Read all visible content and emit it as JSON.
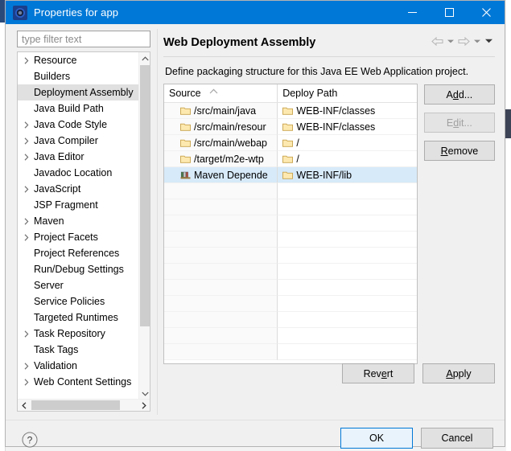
{
  "window": {
    "title": "Properties for app",
    "icon": "gear-icon",
    "accent_color": "#0078d7",
    "controls": {
      "minimize": "minimize-icon",
      "maximize": "maximize-icon",
      "close": "close-icon"
    }
  },
  "filter": {
    "placeholder": "type filter text",
    "value": ""
  },
  "tree": {
    "items": [
      {
        "label": "Resource",
        "expandable": true,
        "selected": false
      },
      {
        "label": "Builders",
        "expandable": false,
        "selected": false
      },
      {
        "label": "Deployment Assembly",
        "expandable": false,
        "selected": true
      },
      {
        "label": "Java Build Path",
        "expandable": false,
        "selected": false
      },
      {
        "label": "Java Code Style",
        "expandable": true,
        "selected": false
      },
      {
        "label": "Java Compiler",
        "expandable": true,
        "selected": false
      },
      {
        "label": "Java Editor",
        "expandable": true,
        "selected": false
      },
      {
        "label": "Javadoc Location",
        "expandable": false,
        "selected": false
      },
      {
        "label": "JavaScript",
        "expandable": true,
        "selected": false
      },
      {
        "label": "JSP Fragment",
        "expandable": false,
        "selected": false
      },
      {
        "label": "Maven",
        "expandable": true,
        "selected": false
      },
      {
        "label": "Project Facets",
        "expandable": true,
        "selected": false
      },
      {
        "label": "Project References",
        "expandable": false,
        "selected": false
      },
      {
        "label": "Run/Debug Settings",
        "expandable": false,
        "selected": false
      },
      {
        "label": "Server",
        "expandable": false,
        "selected": false
      },
      {
        "label": "Service Policies",
        "expandable": false,
        "selected": false
      },
      {
        "label": "Targeted Runtimes",
        "expandable": false,
        "selected": false
      },
      {
        "label": "Task Repository",
        "expandable": true,
        "selected": false
      },
      {
        "label": "Task Tags",
        "expandable": false,
        "selected": false
      },
      {
        "label": "Validation",
        "expandable": true,
        "selected": false
      },
      {
        "label": "Web Content Settings",
        "expandable": true,
        "selected": false
      }
    ]
  },
  "page": {
    "title": "Web Deployment Assembly",
    "description": "Define packaging structure for this Java EE Web Application project.",
    "nav": {
      "back": "back-arrow-icon",
      "back_menu": "chevron-down-icon",
      "forward": "forward-arrow-icon",
      "forward_menu": "chevron-down-icon",
      "view_menu": "chevron-down-icon"
    }
  },
  "table": {
    "columns": [
      "Source",
      "Deploy Path"
    ],
    "sort_indicator": "sort-ascending-icon",
    "rows": [
      {
        "source": "/src/main/java",
        "source_icon": "folder-icon",
        "deploy": "WEB-INF/classes",
        "deploy_icon": "folder-icon",
        "selected": false
      },
      {
        "source": "/src/main/resour",
        "source_icon": "folder-icon",
        "deploy": "WEB-INF/classes",
        "deploy_icon": "folder-icon",
        "selected": false
      },
      {
        "source": "/src/main/webap",
        "source_icon": "folder-icon",
        "deploy": "/",
        "deploy_icon": "folder-icon",
        "selected": false
      },
      {
        "source": "/target/m2e-wtp",
        "source_icon": "folder-icon",
        "deploy": "/",
        "deploy_icon": "folder-icon",
        "selected": false
      },
      {
        "source": "Maven Depende",
        "source_icon": "library-icon",
        "deploy": "WEB-INF/lib",
        "deploy_icon": "folder-icon",
        "selected": true
      }
    ],
    "empty_row_count": 11
  },
  "side_buttons": [
    {
      "label": "Add...",
      "mnemonic_index": 1,
      "enabled": true
    },
    {
      "label": "Edit...",
      "mnemonic_index": 1,
      "enabled": false
    },
    {
      "label": "Remove",
      "mnemonic_index": 0,
      "enabled": true
    }
  ],
  "form_buttons": {
    "revert": {
      "label": "Revert",
      "mnemonic_index": 3
    },
    "apply": {
      "label": "Apply",
      "mnemonic_index": 0
    }
  },
  "dialog_buttons": {
    "help": "help-icon",
    "ok": "OK",
    "cancel": "Cancel"
  }
}
